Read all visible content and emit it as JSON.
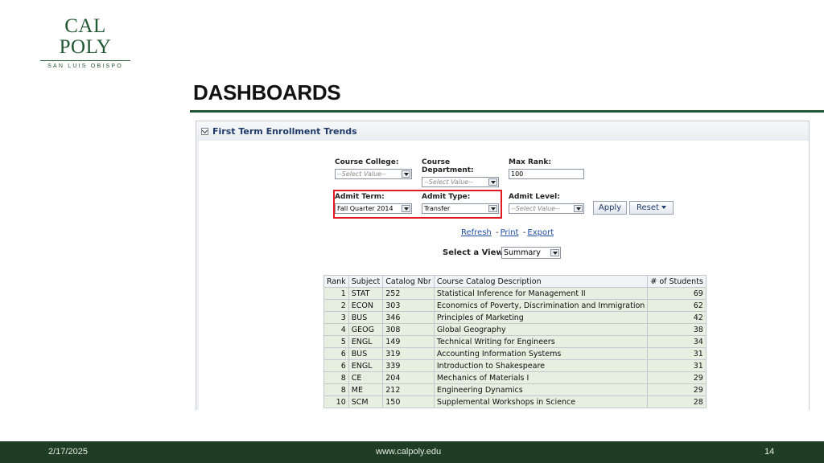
{
  "logo": {
    "main": "CAL POLY",
    "sub": "SAN LUIS OBISPO"
  },
  "slide": {
    "title": "DASHBOARDS"
  },
  "panel": {
    "title": "First Term Enrollment Trends"
  },
  "prompts": {
    "course_college": {
      "label": "Course College:",
      "value": "--Select Value--"
    },
    "course_department": {
      "label": "Course Department:",
      "value": "--Select Value--"
    },
    "max_rank": {
      "label": "Max Rank:",
      "value": "100"
    },
    "admit_term": {
      "label": "Admit Term:",
      "value": "Fall Quarter 2014"
    },
    "admit_type": {
      "label": "Admit Type:",
      "value": "Transfer"
    },
    "admit_level": {
      "label": "Admit Level:",
      "value": "--Select Value--"
    }
  },
  "buttons": {
    "apply": "Apply",
    "reset": "Reset"
  },
  "links": {
    "refresh": "Refresh",
    "print": "Print",
    "export": "Export",
    "separator": "-"
  },
  "view": {
    "label": "Select a View:",
    "value": "Summary"
  },
  "table": {
    "headers": [
      "Rank",
      "Subject",
      "Catalog Nbr",
      "Course Catalog Description",
      "# of Students"
    ],
    "rows": [
      [
        "1",
        "STAT",
        "252",
        "Statistical Inference for Management II",
        "69"
      ],
      [
        "2",
        "ECON",
        "303",
        "Economics of Poverty, Discrimination and Immigration",
        "62"
      ],
      [
        "3",
        "BUS",
        "346",
        "Principles of Marketing",
        "42"
      ],
      [
        "4",
        "GEOG",
        "308",
        "Global Geography",
        "38"
      ],
      [
        "5",
        "ENGL",
        "149",
        "Technical Writing for Engineers",
        "34"
      ],
      [
        "6",
        "BUS",
        "319",
        "Accounting Information Systems",
        "31"
      ],
      [
        "6",
        "ENGL",
        "339",
        "Introduction to Shakespeare",
        "31"
      ],
      [
        "8",
        "CE",
        "204",
        "Mechanics of Materials I",
        "29"
      ],
      [
        "8",
        "ME",
        "212",
        "Engineering Dynamics",
        "29"
      ],
      [
        "10",
        "SCM",
        "150",
        "Supplemental Workshops in Science",
        "28"
      ]
    ]
  },
  "footer": {
    "date": "2/17/2025",
    "url": "www.calpoly.edu",
    "page": "14"
  },
  "colors": {
    "brand_green": "#215732",
    "footer_bg": "#1f3d24",
    "highlight": "#e01b24",
    "row_bg": "#e7efe0"
  }
}
